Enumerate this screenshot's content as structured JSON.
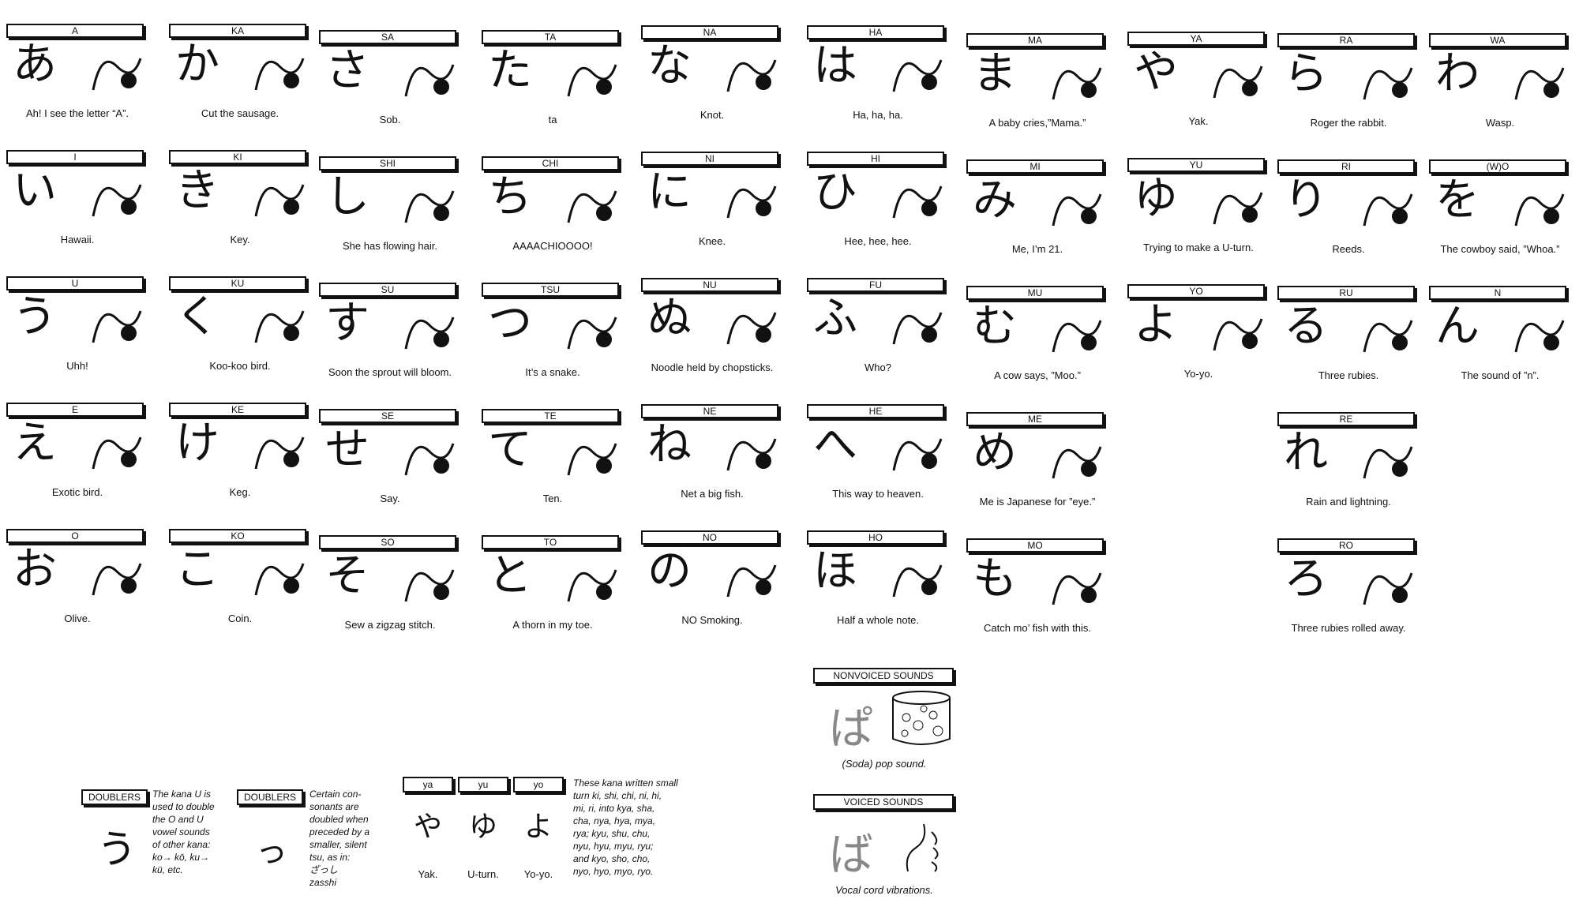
{
  "cards": [
    {
      "hdr": "A",
      "kana": "あ",
      "cap": "Ah! I see the letter “A”.",
      "pic": "letter-a-picture"
    },
    {
      "hdr": "I",
      "kana": "い",
      "cap": "Hawaii.",
      "pic": "double-i-picture"
    },
    {
      "hdr": "U",
      "kana": "う",
      "cap": "Uhh!",
      "pic": "hand-picture"
    },
    {
      "hdr": "E",
      "kana": "え",
      "cap": "Exotic bird.",
      "pic": "bird-picture"
    },
    {
      "hdr": "O",
      "kana": "お",
      "cap": "Olive.",
      "pic": "olive-glass-picture"
    },
    {
      "hdr": "KA",
      "kana": "か",
      "cap": "Cut the sausage.",
      "pic": "knife-picture"
    },
    {
      "hdr": "KI",
      "kana": "き",
      "cap": "Key.",
      "pic": "key-picture"
    },
    {
      "hdr": "KU",
      "kana": "く",
      "cap": "Koo-koo bird.",
      "pic": "bird-head-picture"
    },
    {
      "hdr": "KE",
      "kana": "け",
      "cap": "Keg.",
      "pic": "keg-picture"
    },
    {
      "hdr": "KO",
      "kana": "こ",
      "cap": "Coin.",
      "pic": "coin-picture"
    },
    {
      "hdr": "SA",
      "kana": "さ",
      "cap": "Sob.",
      "pic": "sob-face-picture"
    },
    {
      "hdr": "SHI",
      "kana": "し",
      "cap": "She has flowing hair.",
      "pic": "hair-picture"
    },
    {
      "hdr": "SU",
      "kana": "す",
      "cap": "Soon the sprout will bloom.",
      "pic": "sprout-picture"
    },
    {
      "hdr": "SE",
      "kana": "せ",
      "cap": "Say.",
      "pic": "say-face-picture"
    },
    {
      "hdr": "SO",
      "kana": "そ",
      "cap": "Sew a zigzag stitch.",
      "pic": "stitch-picture"
    },
    {
      "hdr": "TA",
      "kana": "た",
      "cap": "ta",
      "pic": "ta-letters-picture"
    },
    {
      "hdr": "CHI",
      "kana": "ち",
      "cap": "AAAACHIOOOO!",
      "pic": "sneeze-picture"
    },
    {
      "hdr": "TSU",
      "kana": "つ",
      "cap": "It’s a snake.",
      "pic": "snake-picture"
    },
    {
      "hdr": "TE",
      "kana": "て",
      "cap": "Ten.",
      "pic": "ten-script-picture"
    },
    {
      "hdr": "TO",
      "kana": "と",
      "cap": "A thorn in my toe.",
      "pic": "toe-picture"
    },
    {
      "hdr": "NA",
      "kana": "な",
      "cap": "Knot.",
      "pic": "knot-picture"
    },
    {
      "hdr": "NI",
      "kana": "に",
      "cap": "Knee.",
      "pic": "knees-picture"
    },
    {
      "hdr": "NU",
      "kana": "ぬ",
      "cap": "Noodle held by chopsticks.",
      "pic": "chopsticks-picture"
    },
    {
      "hdr": "NE",
      "kana": "ね",
      "cap": "Net a big fish.",
      "pic": "fisher-picture"
    },
    {
      "hdr": "NO",
      "kana": "の",
      "cap": "NO Smoking.",
      "pic": "no-smoking-picture"
    },
    {
      "hdr": "HA",
      "kana": "は",
      "cap": "Ha, ha, ha.",
      "pic": "ha-ha-picture"
    },
    {
      "hdr": "HI",
      "kana": "ひ",
      "cap": "Hee, hee, hee.",
      "pic": "laughing-mouth-picture"
    },
    {
      "hdr": "FU",
      "kana": "ふ",
      "cap": "Who?",
      "pic": "question-picture"
    },
    {
      "hdr": "HE",
      "kana": "へ",
      "cap": "This way to heaven.",
      "pic": "arrow-up-picture"
    },
    {
      "hdr": "HO",
      "kana": "ほ",
      "cap": "Half a whole note.",
      "pic": "half-note-picture"
    },
    {
      "hdr": "MA",
      "kana": "ま",
      "cap": "A baby cries,”Mama.”",
      "pic": "baby-picture"
    },
    {
      "hdr": "MI",
      "kana": "み",
      "cap": "Me, I’m 21.",
      "pic": "speech-bubble-picture"
    },
    {
      "hdr": "MU",
      "kana": "む",
      "cap": "A cow says, ”Moo.”",
      "pic": "cow-picture"
    },
    {
      "hdr": "ME",
      "kana": "め",
      "cap": "Me is Japanese for ”eye.”",
      "pic": "eye-picture"
    },
    {
      "hdr": "MO",
      "kana": "も",
      "cap": "Catch mo’ fish with this.",
      "pic": "hook-picture"
    },
    {
      "hdr": "YA",
      "kana": "や",
      "cap": "Yak.",
      "pic": "yak-picture"
    },
    {
      "hdr": "YU",
      "kana": "ゆ",
      "cap": "Trying to make a U-turn.",
      "pic": "u-turn-picture"
    },
    {
      "hdr": "YO",
      "kana": "よ",
      "cap": "Yo-yo.",
      "pic": "yoyo-picture"
    },
    {
      "hdr": "RA",
      "kana": "ら",
      "cap": "Roger the rabbit.",
      "pic": "rabbit-picture"
    },
    {
      "hdr": "RI",
      "kana": "り",
      "cap": "Reeds.",
      "pic": "reeds-picture"
    },
    {
      "hdr": "RU",
      "kana": "る",
      "cap": "Three rubies.",
      "pic": "rubies-picture"
    },
    {
      "hdr": "RE",
      "kana": "れ",
      "cap": "Rain and lightning.",
      "pic": "lightning-picture"
    },
    {
      "hdr": "RO",
      "kana": "ろ",
      "cap": "Three rubies rolled away.",
      "pic": "three-picture"
    },
    {
      "hdr": "WA",
      "kana": "わ",
      "cap": "Wasp.",
      "pic": "wasp-picture"
    },
    {
      "hdr": "(W)O",
      "kana": "を",
      "cap": "The cowboy said, ”Whoa.”",
      "pic": "cowboy-picture"
    },
    {
      "hdr": "N",
      "kana": "ん",
      "cap": "The sound of ”n”.",
      "pic": "n-script-picture"
    }
  ],
  "special": {
    "nonvoiced": {
      "tag": "NONVOICED SOUNDS",
      "kana": "ぱ",
      "cap": "(Soda) pop sound."
    },
    "voiced": {
      "tag": "VOICED SOUNDS",
      "kana": "ば",
      "cap": "Vocal cord vibrations."
    },
    "doublers1": {
      "tag": "DOUBLERS",
      "kana": "う",
      "text": [
        "The kana U is",
        "used to double",
        "the O and U",
        "vowel sounds",
        "of other kana:",
        "ko→ kō, ku→",
        "kū, etc."
      ]
    },
    "doublers2": {
      "tag": "DOUBLERS",
      "kana": "っ",
      "text": [
        "Certain con-",
        "sonants are",
        "doubled when",
        "preceded by a",
        "smaller, silent",
        "tsu, as in:",
        "ざっし",
        "zasshi"
      ]
    },
    "smallkana": {
      "tags": [
        "ya",
        "yu",
        "yo"
      ],
      "kana": [
        "や",
        "ゆ",
        "よ"
      ],
      "caps": [
        "Yak.",
        "U-turn.",
        "Yo-yo."
      ],
      "text": [
        "These kana written small",
        "turn ki, shi, chi, ni, hi,",
        "mi, ri, into kya, sha,",
        "cha, nya, hya, mya,",
        "rya; kyu, shu, chu,",
        "nyu, hyu, myu, ryu;",
        "and kyo, sho, cho,",
        "nyo, hyo, myo, ryo."
      ]
    }
  }
}
